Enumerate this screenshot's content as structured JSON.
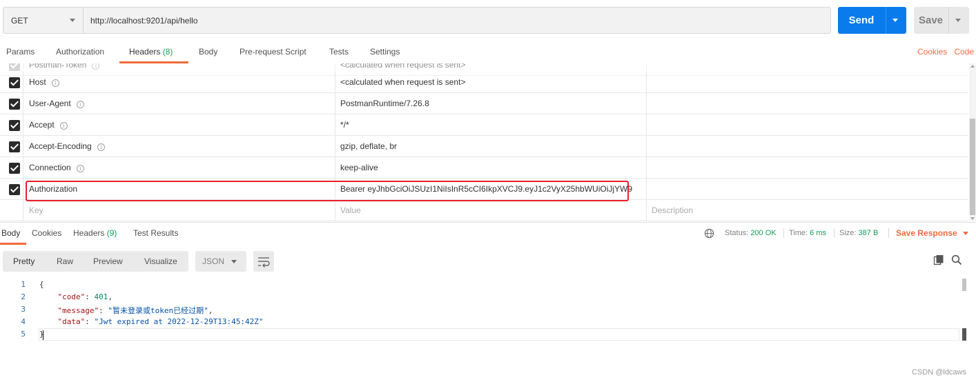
{
  "request": {
    "method": "GET",
    "url": "http://localhost:9201/api/hello",
    "send_label": "Send",
    "save_label": "Save"
  },
  "request_tabs": {
    "params": "Params",
    "authorization": "Authorization",
    "headers": "Headers",
    "headers_count": "(8)",
    "body": "Body",
    "prerequest": "Pre-request Script",
    "tests": "Tests",
    "settings": "Settings",
    "cookies": "Cookies",
    "code": "Code"
  },
  "headers": {
    "partial_row": {
      "key": "Postman-Token",
      "value": "<calculated when request is sent>"
    },
    "rows": [
      {
        "key": "Host",
        "value": "<calculated when request is sent>"
      },
      {
        "key": "User-Agent",
        "value": "PostmanRuntime/7.26.8"
      },
      {
        "key": "Accept",
        "value": "*/*"
      },
      {
        "key": "Accept-Encoding",
        "value": "gzip, deflate, br"
      },
      {
        "key": "Connection",
        "value": "keep-alive"
      },
      {
        "key": "Authorization",
        "value": "Bearer eyJhbGciOiJSUzI1NiIsInR5cCI6IkpXVCJ9.eyJ1c2VyX25hbWUiOiJjYW9"
      }
    ],
    "placeholders": {
      "key": "Key",
      "value": "Value",
      "description": "Description"
    }
  },
  "response_tabs": {
    "body": "Body",
    "cookies": "Cookies",
    "headers": "Headers",
    "headers_count": "(9)",
    "test_results": "Test Results"
  },
  "status": {
    "status_label": "Status:",
    "status_value": "200 OK",
    "time_label": "Time:",
    "time_value": "6 ms",
    "size_label": "Size:",
    "size_value": "387 B",
    "save_response": "Save Response"
  },
  "view": {
    "pretty": "Pretty",
    "raw": "Raw",
    "preview": "Preview",
    "visualize": "Visualize",
    "format": "JSON"
  },
  "code": {
    "line_numbers": [
      "1",
      "2",
      "3",
      "4",
      "5"
    ],
    "open_brace": "{",
    "close_brace": "}",
    "code_key": "\"code\"",
    "code_value": "401",
    "message_key": "\"message\"",
    "message_value": "\"暂未登录或token已经过期\"",
    "data_key": "\"data\"",
    "data_value": "\"Jwt expired at 2022-12-29T13:45:42Z\""
  },
  "watermark": "CSDN @ldcaws",
  "colors": {
    "accent": "#f26b3a",
    "send": "#097bed",
    "success": "#0f9d58",
    "highlight_box": "#e8202a"
  }
}
